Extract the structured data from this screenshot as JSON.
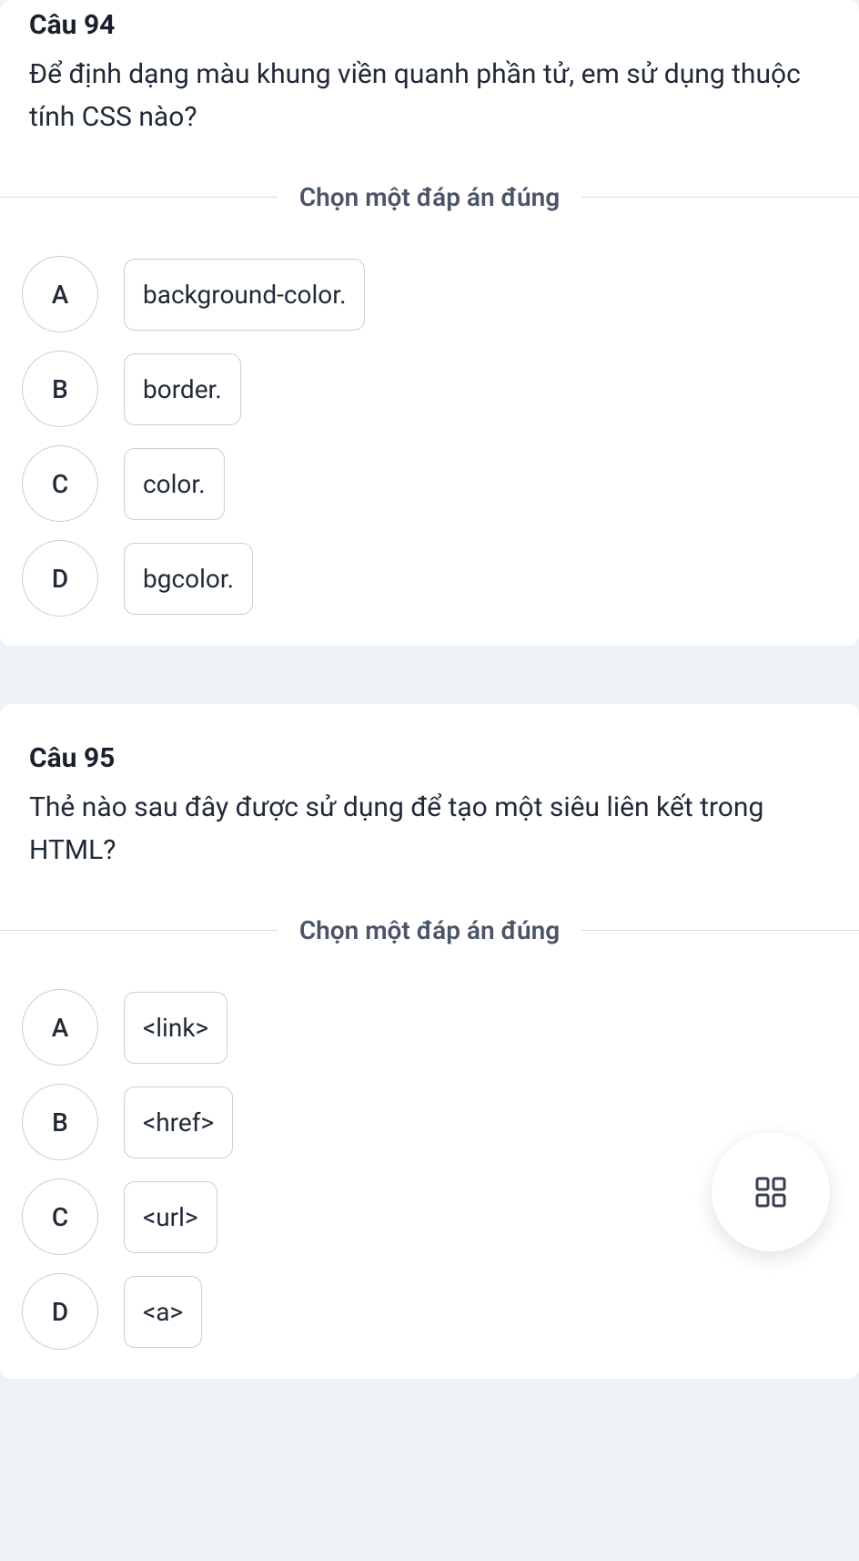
{
  "questions": [
    {
      "number": "Câu 94",
      "text": "Để định dạng màu khung viền quanh phần tử, em sử dụng thuộc tính CSS nào?",
      "prompt": "Chọn một đáp án đúng",
      "options": [
        {
          "letter": "A",
          "text": "background-color."
        },
        {
          "letter": "B",
          "text": "border."
        },
        {
          "letter": "C",
          "text": "color."
        },
        {
          "letter": "D",
          "text": "bgcolor."
        }
      ]
    },
    {
      "number": "Câu 95",
      "text": "Thẻ nào sau đây được sử dụng để tạo một siêu liên kết trong HTML?",
      "prompt": "Chọn một đáp án đúng",
      "options": [
        {
          "letter": "A",
          "text": "<link>"
        },
        {
          "letter": "B",
          "text": "<href>"
        },
        {
          "letter": "C",
          "text": "<url>"
        },
        {
          "letter": "D",
          "text": "<a>"
        }
      ]
    }
  ],
  "fab": {
    "icon": "grid-icon"
  }
}
